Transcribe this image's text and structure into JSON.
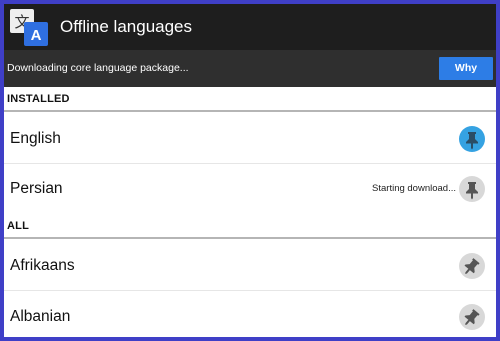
{
  "app": {
    "title": "Offline languages",
    "logo_icon": "translate-icon"
  },
  "banner": {
    "text": "Downloading core language package...",
    "button_label": "Why"
  },
  "sections": {
    "installed": {
      "label": "INSTALLED"
    },
    "all": {
      "label": "ALL"
    }
  },
  "languages": {
    "installed": [
      {
        "name": "English",
        "status": "",
        "pin": "pin-icon",
        "pin_state": "pinned"
      },
      {
        "name": "Persian",
        "status": "Starting download...",
        "pin": "pin-icon",
        "pin_state": "downloading"
      }
    ],
    "all": [
      {
        "name": "Afrikaans",
        "status": "",
        "pin": "pin-icon",
        "pin_state": "unpinned"
      },
      {
        "name": "Albanian",
        "status": "",
        "pin": "pin-icon",
        "pin_state": "unpinned"
      }
    ]
  },
  "colors": {
    "appbar": "#1e1e1e",
    "banner": "#2f2f2f",
    "accent": "#2d7de6",
    "pin_active": "#35a2e2",
    "frame": "#3f3fc7"
  }
}
